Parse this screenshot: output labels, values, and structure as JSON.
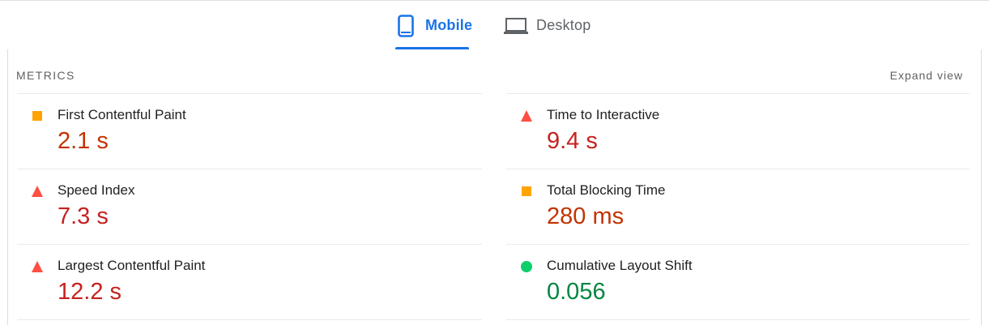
{
  "tabs": [
    {
      "label": "Mobile",
      "icon": "mobile-phone-icon",
      "active": true
    },
    {
      "label": "Desktop",
      "icon": "laptop-icon",
      "active": false
    }
  ],
  "metrics": {
    "title": "METRICS",
    "expand_label": "Expand view",
    "left": [
      {
        "name": "First Contentful Paint",
        "value": "2.1 s",
        "status": "average"
      },
      {
        "name": "Speed Index",
        "value": "7.3 s",
        "status": "fail"
      },
      {
        "name": "Largest Contentful Paint",
        "value": "12.2 s",
        "status": "fail"
      }
    ],
    "right": [
      {
        "name": "Time to Interactive",
        "value": "9.4 s",
        "status": "fail"
      },
      {
        "name": "Total Blocking Time",
        "value": "280 ms",
        "status": "average"
      },
      {
        "name": "Cumulative Layout Shift",
        "value": "0.056",
        "status": "pass"
      }
    ]
  },
  "colors": {
    "accent": "#1a73e8",
    "fail": "#ff4e42",
    "average": "#ffa400",
    "pass": "#0cce6b",
    "fail_text": "#c5221f",
    "average_text": "#c33300",
    "pass_text": "#018642"
  }
}
